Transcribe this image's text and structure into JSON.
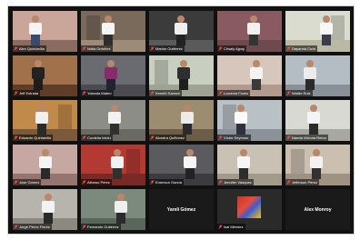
{
  "participants": [
    {
      "name": "Alex Quintanilla",
      "video": true,
      "wall": "#c9a59a",
      "floor": "#8a6b60",
      "shirt": "#f4f4f4",
      "pants": "#3a4a6a"
    },
    {
      "name": "Nidia Ordóñez",
      "video": true,
      "wall": "#7a6a5c",
      "floor": "#9b8b78",
      "shirt": "#f5f5f5",
      "pants": "#2e2e2e"
    },
    {
      "name": "Marlon Gutiérrez",
      "video": true,
      "wall": "#3b3b3b",
      "floor": "#5a5a5a",
      "shirt": "#efefef",
      "pants": "#222222"
    },
    {
      "name": "Crisaly Ajpop",
      "video": true,
      "wall": "#8a5a62",
      "floor": "#6e4a4f",
      "shirt": "#f1f1f1",
      "pants": "#333333"
    },
    {
      "name": "Dayanna Cuxe",
      "video": true,
      "wall": "#d9dccf",
      "floor": "#b9b9a4",
      "shirt": "#f7f7f7",
      "pants": "#3b3b4b"
    },
    {
      "name": "Jeff Estrada",
      "video": true,
      "wall": "#a0714a",
      "floor": "#5e3e28",
      "shirt": "#222222",
      "pants": "#1d1d1d"
    },
    {
      "name": "Yolanda Mateo",
      "video": true,
      "wall": "#6a6b70",
      "floor": "#4a4a50",
      "shirt": "#8a2a6a",
      "pants": "#222233"
    },
    {
      "name": "Keneth Samuel",
      "video": true,
      "wall": "#c8cfc0",
      "floor": "#9ea394",
      "shirt": "#2f2f2f",
      "pants": "#1e1e1e"
    },
    {
      "name": "Lucrecia Flores",
      "video": true,
      "wall": "#d6c6bc",
      "floor": "#b29a8e",
      "shirt": "#f3f3f3",
      "pants": "#3a3a3a"
    },
    {
      "name": "Walter Ruiz",
      "video": true,
      "wall": "#b4bcc4",
      "floor": "#8a9098",
      "shirt": "#ececec",
      "pants": "#2a2a2a"
    },
    {
      "name": "Eduardo Quintanilla",
      "video": true,
      "wall": "#c28a4a",
      "floor": "#7a5a3a",
      "shirt": "#f0f0f0",
      "pants": "#2a2a2a"
    },
    {
      "name": "Cordelia Ixtulul",
      "video": true,
      "wall": "#8c8d86",
      "floor": "#6b6a62",
      "shirt": "#f2f2f2",
      "pants": "#303030"
    },
    {
      "name": "Alondra Quiñónez",
      "video": true,
      "wall": "#9c8d70",
      "floor": "#6c5d48",
      "shirt": "#ebebeb",
      "pants": "#2a2a2a"
    },
    {
      "name": "Víctor Seymour",
      "video": true,
      "wall": "#b9c0c6",
      "floor": "#8b9298",
      "shirt": "#fafafa",
      "pants": "#303040"
    },
    {
      "name": "Nanda Victoria Reina",
      "video": true,
      "wall": "#d7d9d2",
      "floor": "#a8a8a0",
      "shirt": "#f4f4f4",
      "pants": "#2b2b2b"
    },
    {
      "name": "Jose Gómez",
      "video": true,
      "wall": "#c7a7a2",
      "floor": "#96756e",
      "shirt": "#f4f4f4",
      "pants": "#2a2a2a"
    },
    {
      "name": "Alfonso Pérez",
      "video": true,
      "wall": "#b23a32",
      "floor": "#7a2a24",
      "shirt": "#f1f1f1",
      "pants": "#303030"
    },
    {
      "name": "Emerson García",
      "video": true,
      "wall": "#5b5a5e",
      "floor": "#3c3b3f",
      "shirt": "#f5f5f5",
      "pants": "#222222"
    },
    {
      "name": "Jennifer Vásquez",
      "video": true,
      "wall": "#c9c2b4",
      "floor": "#a29a8a",
      "shirt": "#f6f6f6",
      "pants": "#2d2d2d"
    },
    {
      "name": "Jefferson Pérez",
      "video": true,
      "wall": "#cbbfaf",
      "floor": "#9f9282",
      "shirt": "#f2f2f2",
      "pants": "#323232"
    },
    {
      "name": "Jorge Pérez Flores",
      "video": true,
      "wall": "#b7b3ad",
      "floor": "#8d8880",
      "shirt": "#f3f3f3",
      "pants": "#2a2a2a"
    },
    {
      "name": "Fernando Gutiérrez",
      "video": true,
      "wall": "#7c8a7e",
      "floor": "#5a665c",
      "shirt": "#efefef",
      "pants": "#2b2b2b"
    },
    {
      "name": "Yarelí Gómez",
      "video": false
    },
    {
      "name": "Isai Méndez",
      "video": true,
      "poster": true
    },
    {
      "name": "Alex Monroy",
      "video": false
    }
  ]
}
